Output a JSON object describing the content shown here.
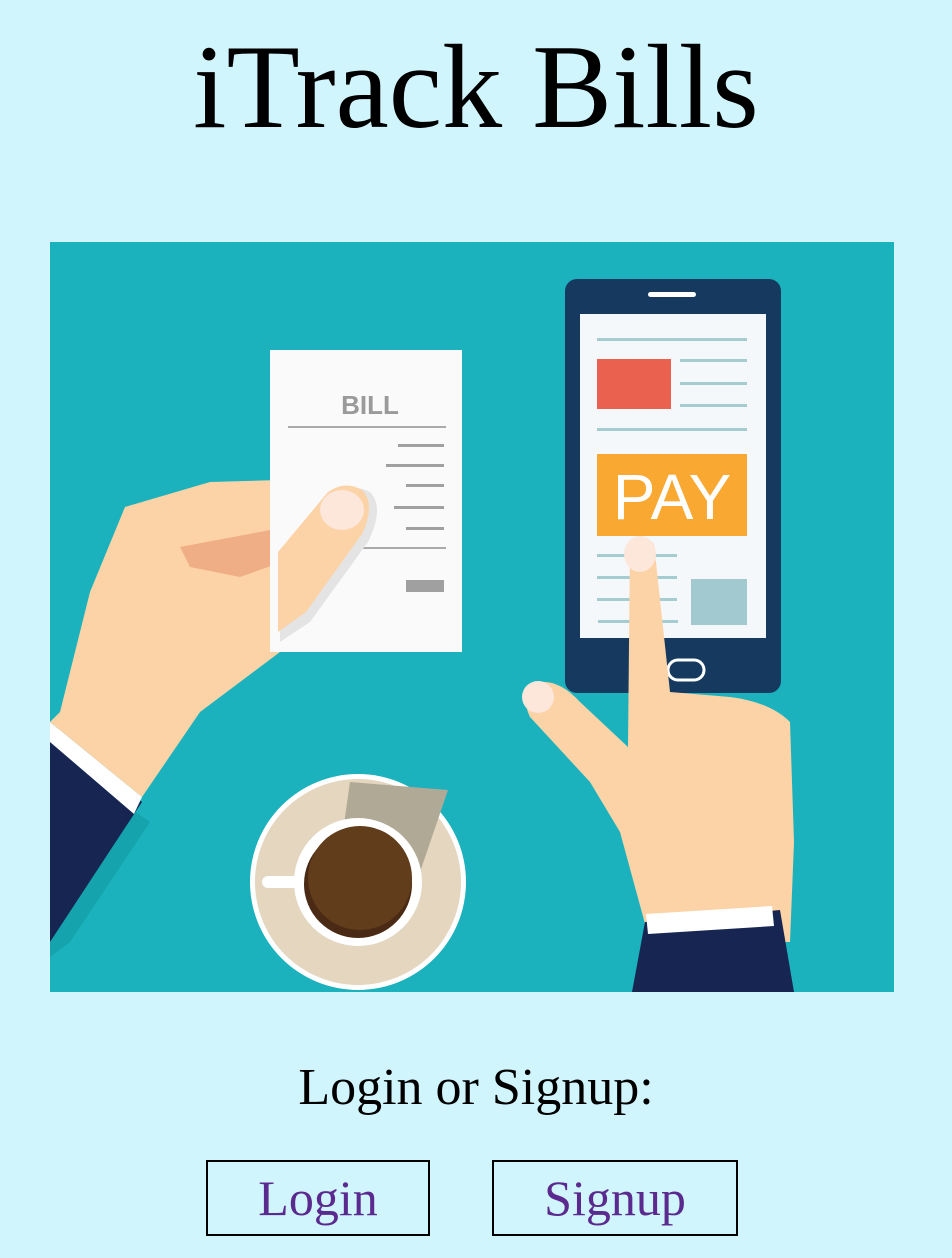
{
  "header": {
    "title": "iTrack Bills"
  },
  "hero": {
    "bill_text": "BILL",
    "pay_text": "PAY",
    "colors": {
      "background": "#1cb2bd",
      "phone": "#163a5f",
      "pay_button": "#f9a832",
      "red_block": "#eb6150",
      "skin": "#fcd3a6",
      "sleeve": "#172552",
      "coffee": "#623d1c"
    }
  },
  "auth": {
    "prompt": "Login or Signup:",
    "login_label": "Login",
    "signup_label": "Signup"
  },
  "colors": {
    "page_background": "#d1f5fd",
    "link_text": "#5b2a8f"
  }
}
